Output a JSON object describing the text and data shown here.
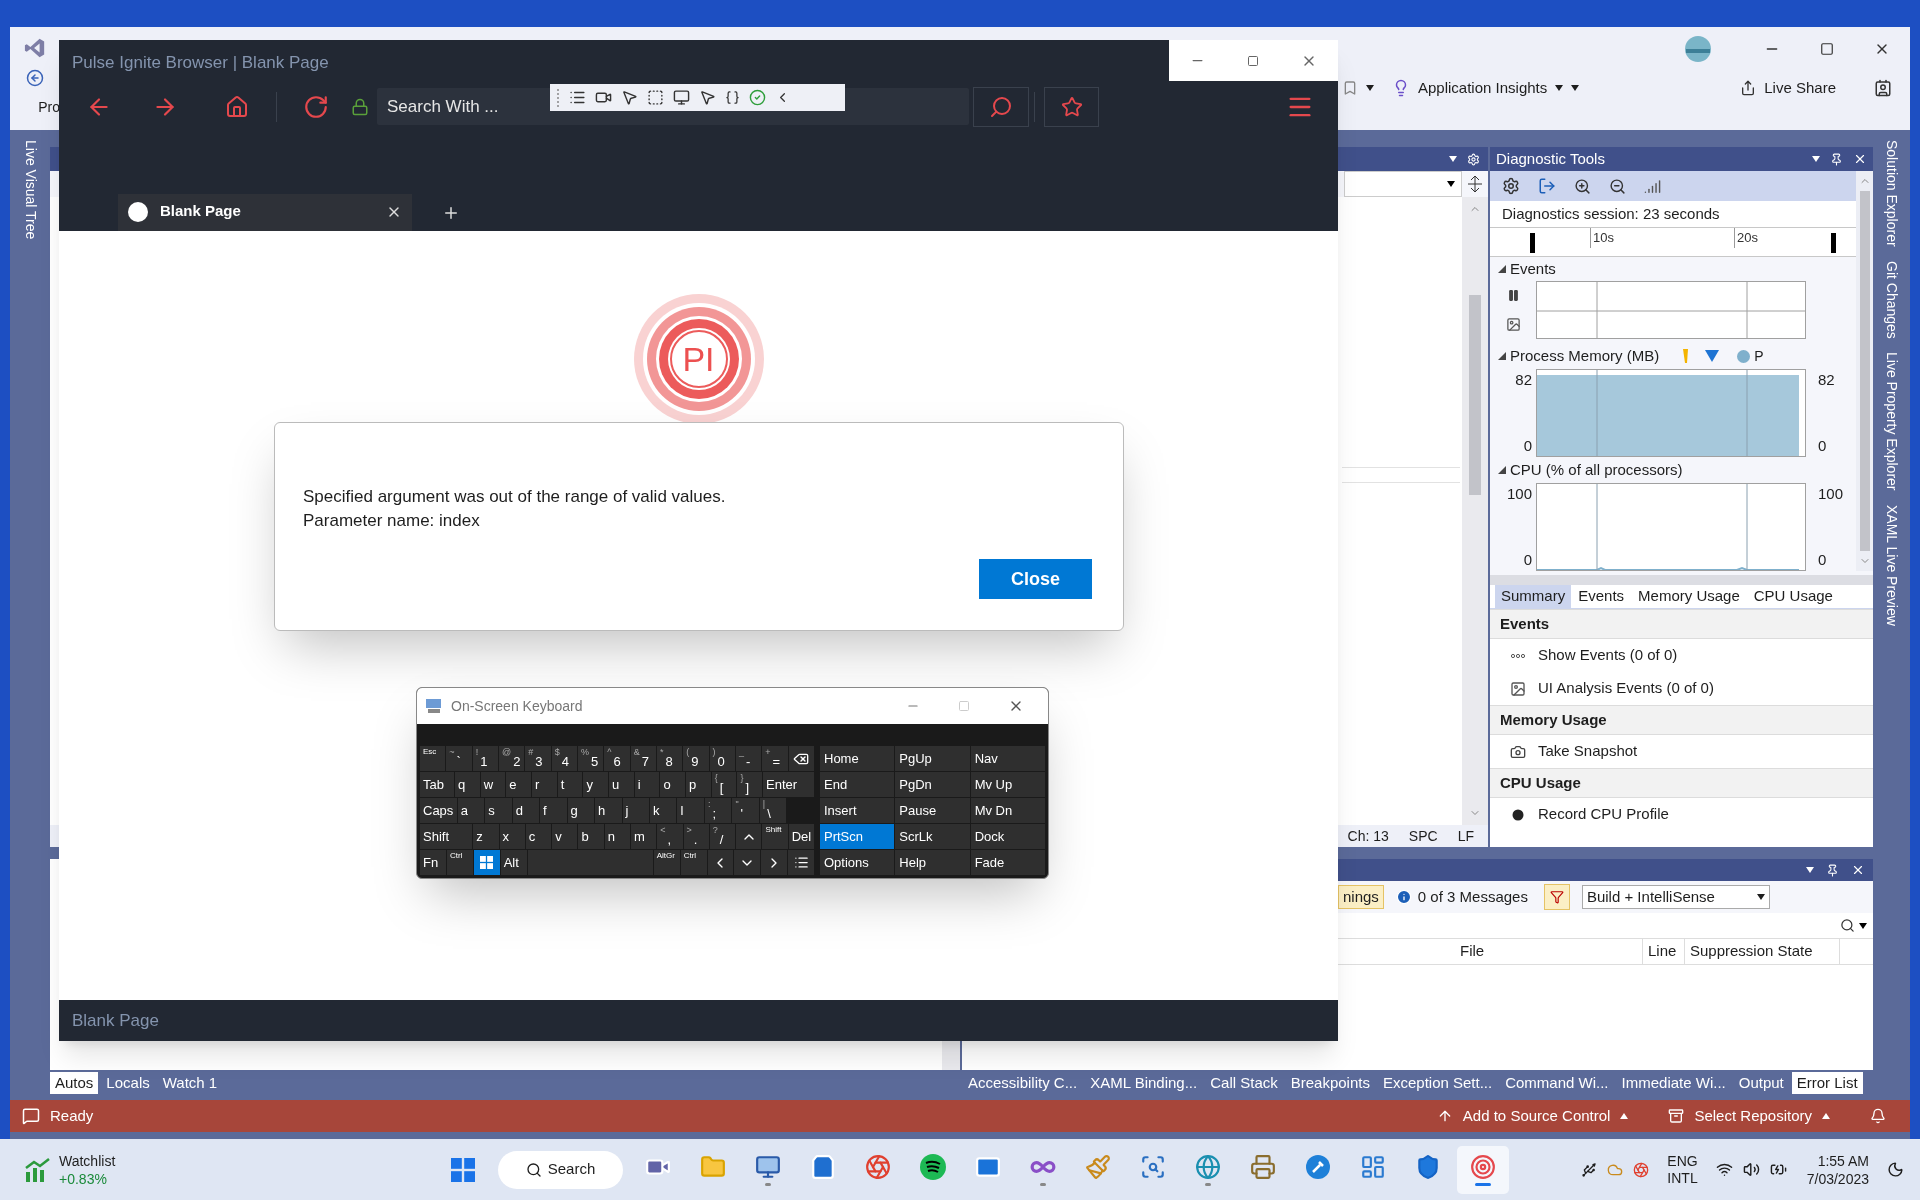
{
  "vs": {
    "project_partial": "Pro",
    "insights": "Application Insights",
    "live_share": "Live Share",
    "left_tabs": [
      "Live Visual Tree"
    ],
    "right_tabs": [
      "Solution Explorer",
      "Git Changes",
      "Live Property Explorer",
      "XAML Live Preview"
    ],
    "editor_status": [
      "Ch: 13",
      "SPC",
      "LF"
    ],
    "diagnostics": {
      "title": "Diagnostic Tools",
      "session": "Diagnostics session: 23 seconds",
      "timeline_ticks": [
        "10s",
        "20s"
      ],
      "events_title": "Events",
      "memory": {
        "title": "Process Memory (MB)",
        "legend": "P",
        "left_ticks": [
          "82",
          "0"
        ],
        "right_ticks": [
          "82",
          "0"
        ]
      },
      "cpu": {
        "title": "CPU (% of all processors)",
        "left_ticks": [
          "100",
          "0"
        ],
        "right_ticks": [
          "100",
          "0"
        ]
      },
      "tabs": [
        {
          "label": "Summary",
          "selected": true
        },
        {
          "label": "Events",
          "selected": false
        },
        {
          "label": "Memory Usage",
          "selected": false
        },
        {
          "label": "CPU Usage",
          "selected": false
        }
      ],
      "sections": [
        {
          "title": "Events",
          "items": [
            {
              "kind": "events",
              "label": "Show Events (0 of 0)"
            },
            {
              "kind": "ui-analysis",
              "label": "UI Analysis Events (0 of 0)"
            }
          ]
        },
        {
          "title": "Memory Usage",
          "items": [
            {
              "kind": "snapshot",
              "label": "Take Snapshot"
            }
          ]
        },
        {
          "title": "CPU Usage",
          "items": [
            {
              "kind": "record",
              "label": "Record CPU Profile"
            }
          ]
        }
      ]
    },
    "error_list": {
      "warnings_partial": "nings",
      "messages": "0 of 3 Messages",
      "scope": "Build + IntelliSense",
      "columns": [
        "File",
        "Line",
        "Suppression State"
      ]
    },
    "bottom_left_tabs": [
      {
        "label": "Autos",
        "selected": true
      },
      {
        "label": "Locals",
        "selected": false
      },
      {
        "label": "Watch 1",
        "selected": false
      }
    ],
    "bottom_right_tabs": [
      {
        "label": "Accessibility C...",
        "selected": false
      },
      {
        "label": "XAML Binding...",
        "selected": false
      },
      {
        "label": "Call Stack",
        "selected": false
      },
      {
        "label": "Breakpoints",
        "selected": false
      },
      {
        "label": "Exception Sett...",
        "selected": false
      },
      {
        "label": "Command Wi...",
        "selected": false
      },
      {
        "label": "Immediate Wi...",
        "selected": false
      },
      {
        "label": "Output",
        "selected": false
      },
      {
        "label": "Error List",
        "selected": true
      }
    ],
    "status_bar": {
      "state": "Ready",
      "source_control": "Add to Source Control",
      "repository": "Select Repository"
    }
  },
  "browser": {
    "title": "Pulse Ignite Browser | Blank Page",
    "search": {
      "placeholder": "Search With ..."
    },
    "tabs": [
      {
        "label": "Blank Page",
        "selected": true
      }
    ],
    "logo": "PI",
    "dialog": {
      "lines": [
        "Specified argument was out of the range of valid values.",
        "Parameter name: index"
      ],
      "button": "Close"
    },
    "footer": "Blank Page"
  },
  "keyboard": {
    "title": "On-Screen Keyboard",
    "rows": [
      {
        "keys": [
          {
            "kind": "small",
            "label": "Esc",
            "on": false
          },
          {
            "kind": "char",
            "top": "~",
            "label": "`",
            "on": false
          },
          {
            "kind": "char",
            "top": "!",
            "label": "1",
            "on": false
          },
          {
            "kind": "char",
            "top": "@",
            "label": "2",
            "on": false
          },
          {
            "kind": "char",
            "top": "#",
            "label": "3",
            "on": false
          },
          {
            "kind": "char",
            "top": "$",
            "label": "4",
            "on": false
          },
          {
            "kind": "char",
            "top": "%",
            "label": "5",
            "on": false
          },
          {
            "kind": "char",
            "top": "^",
            "label": "6",
            "on": false
          },
          {
            "kind": "char",
            "top": "&",
            "label": "7",
            "on": false
          },
          {
            "kind": "char",
            "top": "*",
            "label": "8",
            "on": false
          },
          {
            "kind": "char",
            "top": "(",
            "label": "9",
            "on": false
          },
          {
            "kind": "char",
            "top": ")",
            "label": "0",
            "on": false
          },
          {
            "kind": "char",
            "top": "_",
            "label": "-",
            "on": false
          },
          {
            "kind": "char",
            "top": "+",
            "label": "=",
            "on": false
          },
          {
            "kind": "backspace",
            "on": false
          }
        ]
      },
      {
        "keys": [
          {
            "kind": "long",
            "label": "Tab",
            "on": false
          },
          {
            "kind": "word",
            "label": "q",
            "on": false
          },
          {
            "kind": "word",
            "label": "w",
            "on": false
          },
          {
            "kind": "word",
            "label": "e",
            "on": false
          },
          {
            "kind": "word",
            "label": "r",
            "on": false
          },
          {
            "kind": "word",
            "label": "t",
            "on": false
          },
          {
            "kind": "word",
            "label": "y",
            "on": false
          },
          {
            "kind": "word",
            "label": "u",
            "on": false
          },
          {
            "kind": "word",
            "label": "i",
            "on": false
          },
          {
            "kind": "word",
            "label": "o",
            "on": false
          },
          {
            "kind": "word",
            "label": "p",
            "on": false
          },
          {
            "kind": "char",
            "top": "{",
            "label": "[",
            "on": false
          },
          {
            "kind": "char",
            "top": "}",
            "label": "]",
            "on": false
          },
          {
            "kind": "wide",
            "label": "Enter",
            "on": false
          }
        ]
      },
      {
        "keys": [
          {
            "kind": "long",
            "label": "Caps",
            "on": false
          },
          {
            "kind": "word",
            "label": "a",
            "on": false
          },
          {
            "kind": "word",
            "label": "s",
            "on": false
          },
          {
            "kind": "word",
            "label": "d",
            "on": false
          },
          {
            "kind": "word",
            "label": "f",
            "on": false
          },
          {
            "kind": "word",
            "label": "g",
            "on": false
          },
          {
            "kind": "word",
            "label": "h",
            "on": false
          },
          {
            "kind": "word",
            "label": "j",
            "on": false
          },
          {
            "kind": "word",
            "label": "k",
            "on": false
          },
          {
            "kind": "word",
            "label": "l",
            "on": false
          },
          {
            "kind": "char",
            "top": ":",
            "label": ";",
            "on": false
          },
          {
            "kind": "char",
            "top": "\"",
            "label": "'",
            "on": false
          },
          {
            "kind": "char",
            "top": "|",
            "label": "\\",
            "on": false
          }
        ]
      },
      {
        "keys": [
          {
            "kind": "wide",
            "label": "Shift",
            "on": false
          },
          {
            "kind": "word",
            "label": "z",
            "on": false
          },
          {
            "kind": "word",
            "label": "x",
            "on": false
          },
          {
            "kind": "word",
            "label": "c",
            "on": false
          },
          {
            "kind": "word",
            "label": "v",
            "on": false
          },
          {
            "kind": "word",
            "label": "b",
            "on": false
          },
          {
            "kind": "word",
            "label": "n",
            "on": false
          },
          {
            "kind": "word",
            "label": "m",
            "on": false
          },
          {
            "kind": "char",
            "top": "<",
            "label": ",",
            "on": false
          },
          {
            "kind": "char",
            "top": ">",
            "label": ".",
            "on": false
          },
          {
            "kind": "char",
            "top": "?",
            "label": "/",
            "on": false
          },
          {
            "kind": "up",
            "on": false
          },
          {
            "kind": "small",
            "label": "Shift",
            "on": false
          },
          {
            "kind": "word",
            "label": "Del",
            "on": false
          }
        ]
      },
      {
        "keys": [
          {
            "kind": "word",
            "label": "Fn",
            "on": false
          },
          {
            "kind": "small",
            "label": "Ctrl",
            "on": false
          },
          {
            "kind": "windows",
            "on": true
          },
          {
            "kind": "word",
            "label": "Alt",
            "on": false
          },
          {
            "kind": "space",
            "on": false
          },
          {
            "kind": "small",
            "label": "AltGr",
            "on": false
          },
          {
            "kind": "small",
            "label": "Ctrl",
            "on": false
          },
          {
            "kind": "left",
            "on": false
          },
          {
            "kind": "down",
            "on": false
          },
          {
            "kind": "right",
            "on": false
          },
          {
            "kind": "menu",
            "on": false
          }
        ]
      }
    ],
    "nav": [
      [
        {
          "label": "Home",
          "on": false
        },
        {
          "label": "PgUp",
          "on": false
        },
        {
          "label": "Nav",
          "on": false
        }
      ],
      [
        {
          "label": "End",
          "on": false
        },
        {
          "label": "PgDn",
          "on": false
        },
        {
          "label": "Mv Up",
          "on": false
        }
      ],
      [
        {
          "label": "Insert",
          "on": false
        },
        {
          "label": "Pause",
          "on": false
        },
        {
          "label": "Mv Dn",
          "on": false
        }
      ],
      [
        {
          "label": "PrtScn",
          "on": true
        },
        {
          "label": "ScrLk",
          "on": false
        },
        {
          "label": "Dock",
          "on": false
        }
      ],
      [
        {
          "label": "Options",
          "on": false
        },
        {
          "label": "Help",
          "on": false
        },
        {
          "label": "Fade",
          "on": false
        }
      ]
    ]
  },
  "taskbar": {
    "widget_title": "Watchlist",
    "widget_value": "+0.83%",
    "search": "Search",
    "apps": [
      {
        "kind": "chat",
        "running": false,
        "selected": false
      },
      {
        "kind": "folder",
        "running": false,
        "selected": false
      },
      {
        "kind": "monitor",
        "running": true,
        "selected": false
      },
      {
        "kind": "store",
        "running": false,
        "selected": false
      },
      {
        "kind": "cleaner",
        "running": false,
        "selected": false
      },
      {
        "kind": "music",
        "running": false,
        "selected": false
      },
      {
        "kind": "mail",
        "running": false,
        "selected": false
      },
      {
        "kind": "studio",
        "running": true,
        "selected": false
      },
      {
        "kind": "brush",
        "running": false,
        "selected": false
      },
      {
        "kind": "scan",
        "running": false,
        "selected": false
      },
      {
        "kind": "globe",
        "running": true,
        "selected": false
      },
      {
        "kind": "printer",
        "running": false,
        "selected": false
      },
      {
        "kind": "wrench",
        "running": false,
        "selected": false
      },
      {
        "kind": "panel",
        "running": false,
        "selected": false
      },
      {
        "kind": "shield",
        "running": false,
        "selected": false
      },
      {
        "kind": "target",
        "running": true,
        "selected": true
      }
    ],
    "language": [
      "ENG",
      "INTL"
    ],
    "time": "1:55 AM",
    "date": "7/03/2023"
  }
}
